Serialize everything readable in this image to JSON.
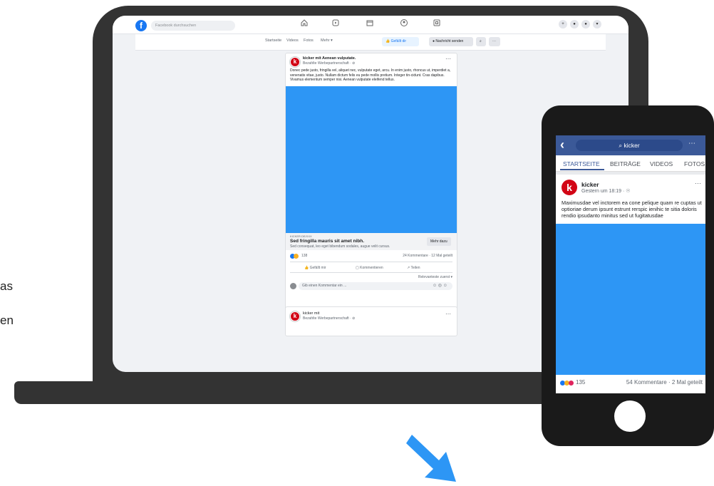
{
  "side_fragments": [
    "as",
    "en"
  ],
  "fb_top": {
    "logo": "f",
    "search_placeholder": "Facebook durchsuchen",
    "nav_icons": [
      "home-icon",
      "video-icon",
      "marketplace-icon",
      "groups-icon",
      "gaming-icon"
    ],
    "right_buttons": [
      "+",
      "●",
      "●",
      "▾"
    ]
  },
  "page_nav": {
    "tabs": [
      "Startseite",
      "Videos",
      "Fotos",
      "Mehr ▾"
    ],
    "like_label": "👍 Gefällt dir",
    "message_label": "● Nachricht senden",
    "search_icon": "⌕",
    "more_icon": "⋯"
  },
  "post1": {
    "avatar": "k",
    "author_line": "kicker mit Aenean vulputate.",
    "sub": "Bezahlte Werbepartnerschaft · ⊘",
    "text": "Donec pede justo, fringilla vel, aliquet nec, vulputate eget, arcu. In enim justo, rhoncus ut, imperdiet a, venenatis vitae, justo. Nullam dictum felis eu pede mollis pretium. Integer tin-cidunt. Cras dapibus. Vivamus elementum semper nisi. Aenean vulputate eleifend tellus.",
    "link_domain": "KICKER.DE/XXX",
    "link_title": "Sed fringilla mauris sit amet nibh.",
    "link_desc": "Sed consequat, leo eget bibendum sodales, augue velit cursus.",
    "cta": "Mehr dazu",
    "reactions_count": "138",
    "stats": "24 Kommentare · 12 Mal geteilt",
    "action_like": "Gefällt mir",
    "action_comment": "Kommentieren",
    "action_share": "Teilen",
    "sort": "Relevanteste zuerst ▾",
    "comment_placeholder": "Gib einen Kommentar ein ..."
  },
  "post2": {
    "avatar": "k",
    "author_line": "kicker mit",
    "sub": "Bezahlte Werbepartnerschaft · ⊘"
  },
  "phone": {
    "back": "‹",
    "search_text": "kicker",
    "more": "⋯",
    "tabs": [
      "STARTSEITE",
      "BEITRÄGE",
      "VIDEOS",
      "FOTOS"
    ],
    "avatar": "k",
    "author": "kicker",
    "time": "Gestern um 18:19 · ☉",
    "post_more": "⋯",
    "text": "Maximusdae vel inctorem ea cone pelique quam re cuptas ut optioriae derum ipsunt estrunt rerspic ienihic te sitia doloris rendio ipsudanto minitus sed ut fugitatusdae",
    "reactions_count": "135",
    "stats": "54 Kommentare · 2 Mal geteilt"
  },
  "colors": {
    "device": "#333333",
    "phone_body": "#1a1a1a",
    "facebook_blue": "#1877f2",
    "media_blue": "#2d96f5",
    "kicker_red": "#d20515",
    "arrow_blue": "#2d96f5"
  }
}
